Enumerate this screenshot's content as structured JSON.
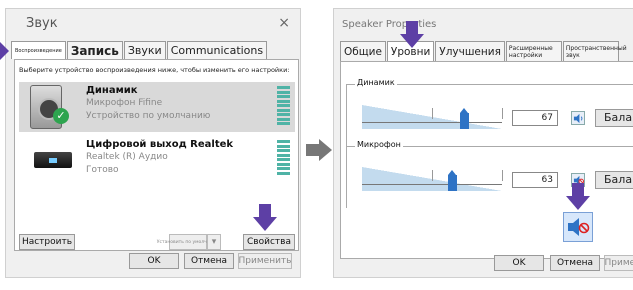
{
  "sound": {
    "title": "Звук",
    "close": "×",
    "tabs": [
      "Воспроизведение",
      "Запись",
      "Звуки",
      "Communications"
    ],
    "instruction": "Выберите устройство воспроизведения ниже, чтобы изменить его настройки:",
    "devices": [
      {
        "name": "Динамик",
        "line1": "Микрофон Fifine",
        "line2": "Устройство по умолчанию",
        "selected": true
      },
      {
        "name": "Цифровой выход Realtek",
        "line1": "Realtek (R) Аудио",
        "line2": "Готово",
        "selected": false
      }
    ],
    "configure": "Настроить",
    "set_default": "Установить по умолчанию",
    "properties": "Свойства",
    "ok": "OK",
    "cancel": "Отмена",
    "apply": "Применить"
  },
  "props": {
    "title": "Speaker Properties",
    "tabs": [
      "Общие",
      "Уровни",
      "Улучшения",
      "Расширенные настройки",
      "Пространственный звук"
    ],
    "speaker_label": "Динамик",
    "speaker_value": "67",
    "mic_label": "Микрофон",
    "mic_value": "63",
    "balance": "Баланс",
    "ok": "OK",
    "cancel": "Отмена",
    "apply": "Применить"
  },
  "colors": {
    "highlight_arrow": "#5d3fa5",
    "slider": "#2e73c5",
    "meter": "#4fb3a6"
  }
}
